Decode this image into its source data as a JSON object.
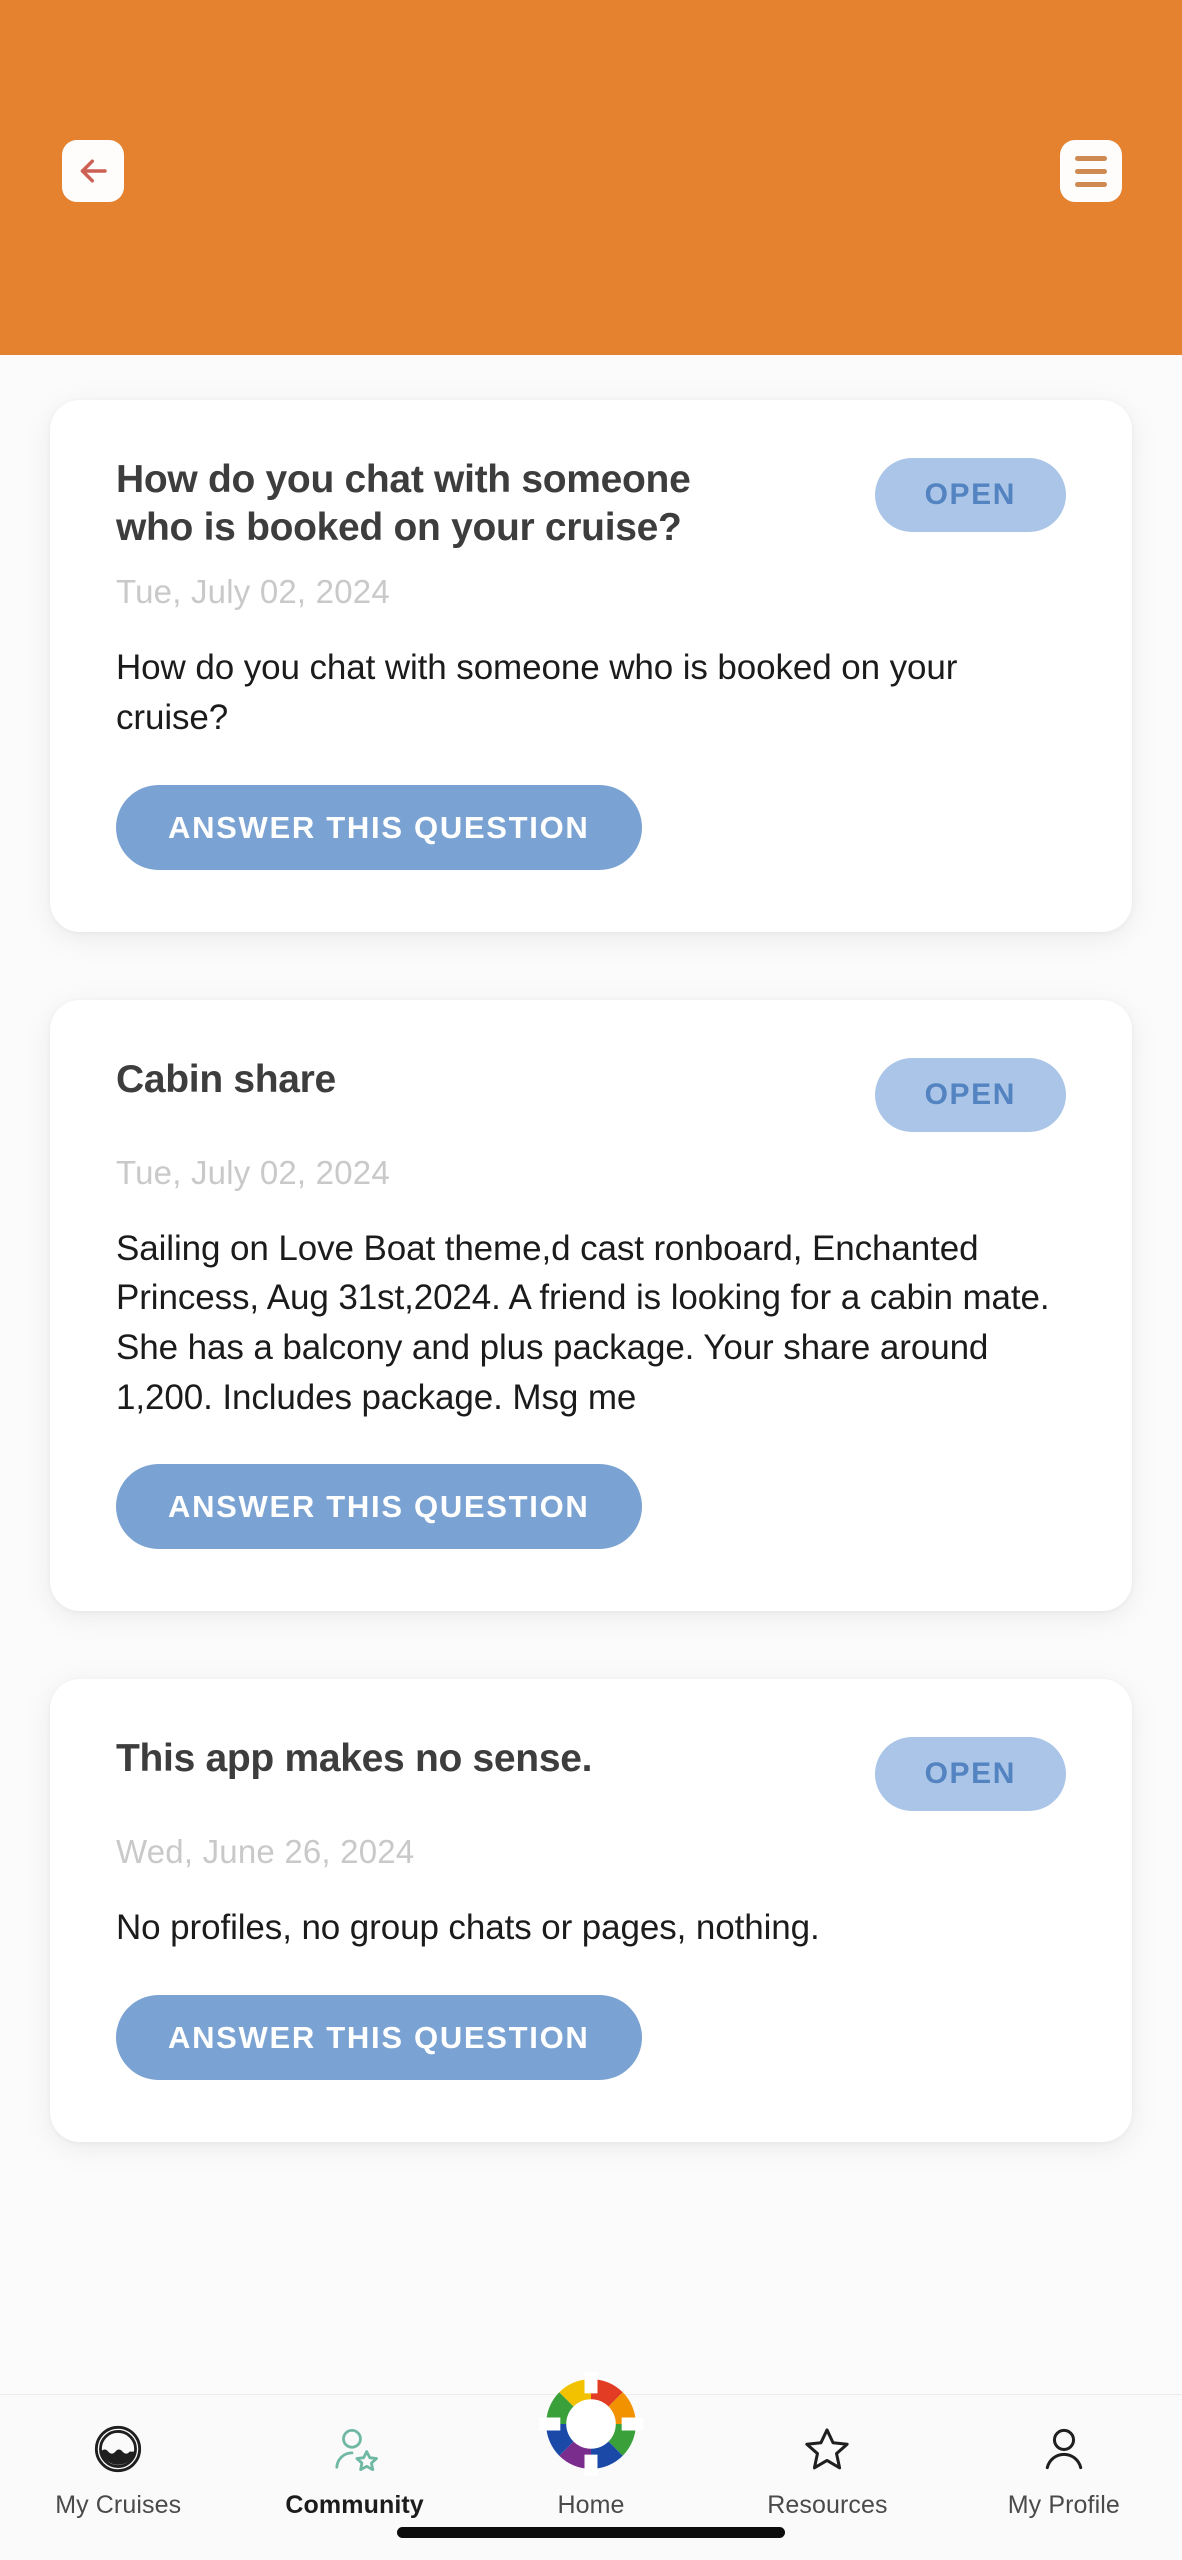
{
  "header": {
    "background_color": "#e4822f",
    "back_icon": "arrow-left-icon",
    "back_icon_color": "#cc6054",
    "menu_icon": "hamburger-menu-icon",
    "menu_icon_color": "#cf8a52",
    "button_background": "#fffdfb"
  },
  "theme": {
    "page_background": "#fbfbfb",
    "card_background": "#ffffff",
    "badge_background": "#aac5e7",
    "badge_text_color": "#5383c0",
    "primary_button_background": "#7aa2d2",
    "primary_button_text_color": "#ffffff",
    "title_color": "#3d3d3d",
    "date_color": "#c9c9c9",
    "body_color": "#1b1b1b",
    "community_accent": "#6fb8a4"
  },
  "posts": [
    {
      "title": "How do you chat with someone who is booked on your cruise?",
      "status": "OPEN",
      "date": "Tue, July 02, 2024",
      "body": "How do you chat with someone who is booked on your cruise?",
      "action_label": "ANSWER THIS QUESTION"
    },
    {
      "title": "Cabin share",
      "status": "OPEN",
      "date": "Tue, July 02, 2024",
      "body": "Sailing on Love Boat theme,d cast ronboard, Enchanted Princess, Aug 31st,2024. A friend is looking for a cabin mate. She has a balcony and plus package. Your share around 1,200. Includes package. Msg me",
      "action_label": "ANSWER THIS QUESTION"
    },
    {
      "title": "This app makes no sense.",
      "status": "OPEN",
      "date": "Wed, June 26, 2024",
      "body": "No profiles, no group chats or pages, nothing.",
      "action_label": "ANSWER THIS QUESTION"
    }
  ],
  "bottom_nav": {
    "items": [
      {
        "label": "My Cruises",
        "icon": "waves-circle-icon",
        "active": false
      },
      {
        "label": "Community",
        "icon": "person-star-icon",
        "active": true
      },
      {
        "label": "Home",
        "icon": "rainbow-life-ring-icon",
        "active": false
      },
      {
        "label": "Resources",
        "icon": "star-icon",
        "active": false
      },
      {
        "label": "My Profile",
        "icon": "person-icon",
        "active": false
      }
    ]
  }
}
